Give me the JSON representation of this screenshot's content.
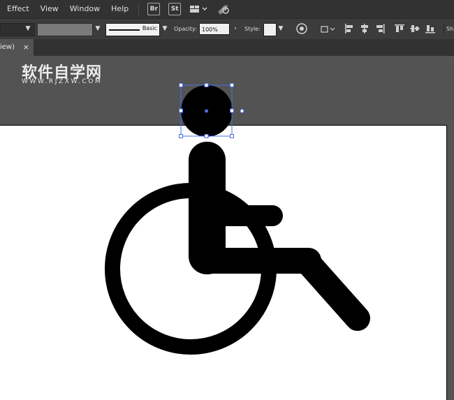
{
  "menubar": {
    "items": [
      "Effect",
      "View",
      "Window",
      "Help"
    ],
    "bridge_label": "Br",
    "stock_label": "St"
  },
  "controlbar": {
    "stroke_style_label": "Basic",
    "opacity_label": "Opacity:",
    "opacity_value": "100%",
    "style_label": "Style:",
    "shape_label_partial": "Sh"
  },
  "tab": {
    "title": "iew)",
    "close": "×"
  },
  "watermark": {
    "text": "软件自学网",
    "url": "WWW.RJZXW.COM"
  },
  "colors": {
    "menubar_bg": "#323232",
    "workspace_bg": "#535353",
    "selection": "#4a6fe3",
    "artwork": "#000000"
  }
}
